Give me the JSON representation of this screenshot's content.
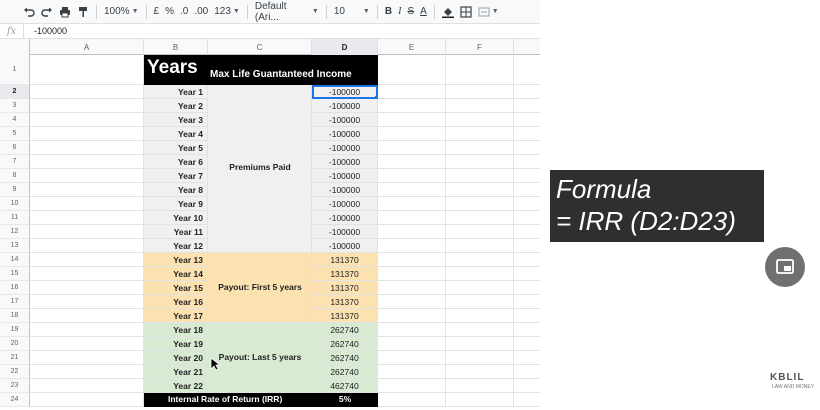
{
  "toolbar": {
    "zoom": "100%",
    "currency": "£",
    "percent": "%",
    "decrease_decimals": ".0",
    "increase_decimals": ".00",
    "more_formats": "123",
    "font": "Default (Ari...",
    "font_size": "10",
    "bold": "B",
    "italic": "I",
    "strike": "S",
    "text_color": "A"
  },
  "formula_bar": {
    "fx": "fx",
    "value": "-100000"
  },
  "columns": [
    "A",
    "B",
    "C",
    "D",
    "E",
    "F"
  ],
  "rows": [
    "1",
    "2",
    "3",
    "4",
    "5",
    "6",
    "7",
    "8",
    "9",
    "10",
    "11",
    "12",
    "13",
    "14",
    "15",
    "16",
    "17",
    "18",
    "19",
    "20",
    "21",
    "22",
    "23",
    "24"
  ],
  "sheet": {
    "title_main": "Years",
    "title_sub": "Max Life Guantanteed Income",
    "years": [
      "Year 1",
      "Year 2",
      "Year 3",
      "Year 4",
      "Year 5",
      "Year 6",
      "Year 7",
      "Year 8",
      "Year 9",
      "Year 10",
      "Year 11",
      "Year 12",
      "Year 13",
      "Year 14",
      "Year 15",
      "Year 16",
      "Year 17",
      "Year 18",
      "Year 19",
      "Year 20",
      "Year 21",
      "Year 22"
    ],
    "values": [
      "-100000",
      "-100000",
      "-100000",
      "-100000",
      "-100000",
      "-100000",
      "-100000",
      "-100000",
      "-100000",
      "-100000",
      "-100000",
      "-100000",
      "131370",
      "131370",
      "131370",
      "131370",
      "131370",
      "262740",
      "262740",
      "262740",
      "262740",
      "462740"
    ],
    "group_premiums": "Premiums Paid",
    "group_payout_first": "Payout: First 5 years",
    "group_payout_last": "Payout: Last 5 years",
    "irr_label": "Internal Rate of Return (IRR)",
    "irr_value": "5%"
  },
  "overlay": {
    "formula_line1": "Formula",
    "formula_line2": "= IRR (D2:D23)"
  },
  "watermark": {
    "logo": "KBLIL",
    "tagline": "LAW AND MONEY"
  },
  "colors": {
    "premiums": "#f0f0f0",
    "payout_first": "#fde2b1",
    "payout_last": "#d9ead3",
    "header_black": "#000000",
    "selection": "#1a73e8"
  }
}
